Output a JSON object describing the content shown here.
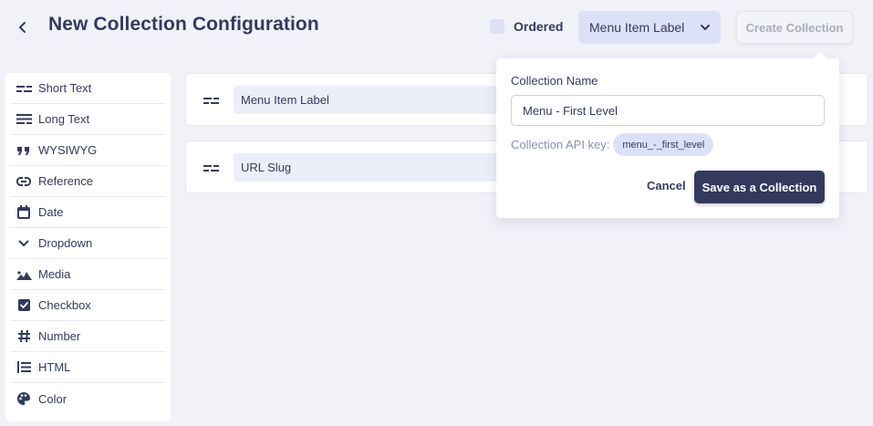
{
  "header": {
    "title": "New Collection Configuration",
    "ordered_label": "Ordered",
    "select_value": "Menu Item Label",
    "create_label": "Create Collection"
  },
  "sidebar": {
    "items": [
      {
        "label": "Short Text",
        "icon": "short-text-icon"
      },
      {
        "label": "Long Text",
        "icon": "long-text-icon"
      },
      {
        "label": "WYSIWYG",
        "icon": "quote-icon"
      },
      {
        "label": "Reference",
        "icon": "link-icon"
      },
      {
        "label": "Date",
        "icon": "calendar-icon"
      },
      {
        "label": "Dropdown",
        "icon": "chevron-down-icon"
      },
      {
        "label": "Media",
        "icon": "image-icon"
      },
      {
        "label": "Checkbox",
        "icon": "checkbox-icon"
      },
      {
        "label": "Number",
        "icon": "hash-icon"
      },
      {
        "label": "HTML",
        "icon": "list-icon"
      },
      {
        "label": "Color",
        "icon": "palette-icon"
      }
    ]
  },
  "fields": [
    {
      "value": "Menu Item Label"
    },
    {
      "value": "URL Slug"
    }
  ],
  "popover": {
    "name_label": "Collection Name",
    "name_value": "Menu - First Level",
    "api_key_label": "Collection API key:",
    "api_key_value": "menu_-_first_level",
    "cancel_label": "Cancel",
    "save_label": "Save as a Collection"
  },
  "colors": {
    "background": "#f1f2f8",
    "primary_dark": "#343a5e",
    "accent_light": "#dde1f8"
  }
}
